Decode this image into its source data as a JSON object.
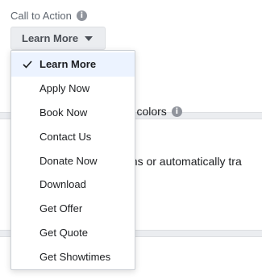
{
  "cta": {
    "label": "Call to Action",
    "info_icon": "i",
    "selected_value": "Learn More"
  },
  "background": {
    "partial_text_1": "nd colors",
    "partial_text_2": "ons or automatically tra",
    "info_icon": "i"
  },
  "menu": {
    "items": [
      {
        "label": "Learn More",
        "selected": true
      },
      {
        "label": "Apply Now"
      },
      {
        "label": "Book Now"
      },
      {
        "label": "Contact Us"
      },
      {
        "label": "Donate Now"
      },
      {
        "label": "Download"
      },
      {
        "label": "Get Offer"
      },
      {
        "label": "Get Quote"
      },
      {
        "label": "Get Showtimes"
      }
    ]
  }
}
